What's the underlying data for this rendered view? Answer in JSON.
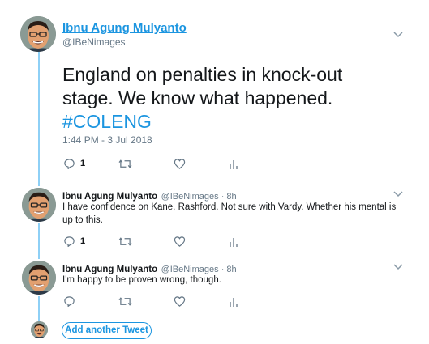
{
  "main_tweet": {
    "display_name": "Ibnu Agung Mulyanto",
    "handle": "@IBeNimages",
    "text_line1": "England on penalties in knock-out",
    "text_line2": "stage. We know what happened.",
    "hashtag": "#COLENG",
    "timestamp": "1:44 PM - 3 Jul 2018",
    "reply_count": "1"
  },
  "replies": [
    {
      "display_name": "Ibnu Agung Mulyanto",
      "handle_time": "@IBeNimages · 8h",
      "text_line1": "I have confidence on Kane, Rashford. Not sure with Vardy. Whether his mental is",
      "text_line2": "up to this.",
      "reply_count": "1"
    },
    {
      "display_name": "Ibnu Agung Mulyanto",
      "handle_time": "@IBeNimages · 8h",
      "text_line1": "I'm happy to be proven wrong, though.",
      "reply_count": ""
    }
  ],
  "compose": {
    "add_button_label": "Add another Tweet"
  },
  "icons": {
    "reply": "reply-icon",
    "retweet": "retweet-icon",
    "like": "heart-icon",
    "analytics": "analytics-icon",
    "more": "chevron-down-icon"
  },
  "colors": {
    "accent": "#1b95e0",
    "thread_line": "#8ed0f6",
    "muted": "#657786"
  }
}
